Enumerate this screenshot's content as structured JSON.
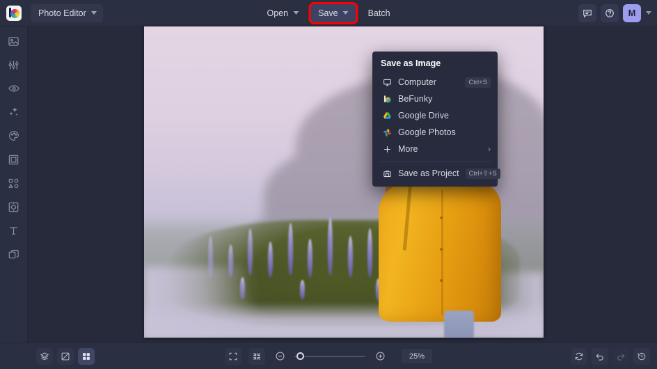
{
  "app": {
    "logo": "befunky-logo-icon",
    "module_name": "Photo Editor"
  },
  "toolbar": {
    "open_label": "Open",
    "save_label": "Save",
    "batch_label": "Batch",
    "highlight_color": "#ff0000",
    "feedback_icon": "feedback-icon",
    "help_icon": "help-icon",
    "avatar_initial": "M"
  },
  "sidebar": {
    "items": [
      {
        "icon": "image-icon",
        "name": "edit"
      },
      {
        "icon": "sliders-icon",
        "name": "adjust"
      },
      {
        "icon": "eye-icon",
        "name": "effects"
      },
      {
        "icon": "sparkles-icon",
        "name": "artsy"
      },
      {
        "icon": "palette-icon",
        "name": "touch-up"
      },
      {
        "icon": "frame-icon",
        "name": "frames"
      },
      {
        "icon": "shapes-icon",
        "name": "graphics"
      },
      {
        "icon": "textures-icon",
        "name": "textures"
      },
      {
        "icon": "text-icon",
        "name": "text"
      },
      {
        "icon": "layers-stack-icon",
        "name": "overlays"
      }
    ]
  },
  "save_menu": {
    "title": "Save as Image",
    "items": [
      {
        "label": "Computer",
        "icon": "monitor-icon",
        "shortcut": "Ctrl+S"
      },
      {
        "label": "BeFunky",
        "icon": "befunky-icon",
        "shortcut": ""
      },
      {
        "label": "Google Drive",
        "icon": "google-drive-icon",
        "shortcut": ""
      },
      {
        "label": "Google Photos",
        "icon": "google-photos-icon",
        "shortcut": ""
      },
      {
        "label": "More",
        "icon": "plus-icon",
        "shortcut": "",
        "submenu": true
      }
    ],
    "project": {
      "label": "Save as Project",
      "icon": "briefcase-icon",
      "shortcut": "Ctrl+⇧+S"
    }
  },
  "bottombar": {
    "layers_icon": "layers-icon",
    "compare_icon": "compare-icon",
    "grid_icon": "grid-icon",
    "fit_icon": "fit-screen-icon",
    "actual_icon": "collapse-icon",
    "zoom_out_icon": "zoom-out-icon",
    "zoom_in_icon": "zoom-in-icon",
    "zoom_level": "25%",
    "reset_icon": "reset-icon",
    "undo_icon": "undo-icon",
    "redo_icon": "redo-icon",
    "history_icon": "history-icon"
  },
  "canvas": {
    "description": "Double exposure photo: woman in yellow raincoat and gray beanie over lupine meadow",
    "background_color": "#262a3b"
  }
}
